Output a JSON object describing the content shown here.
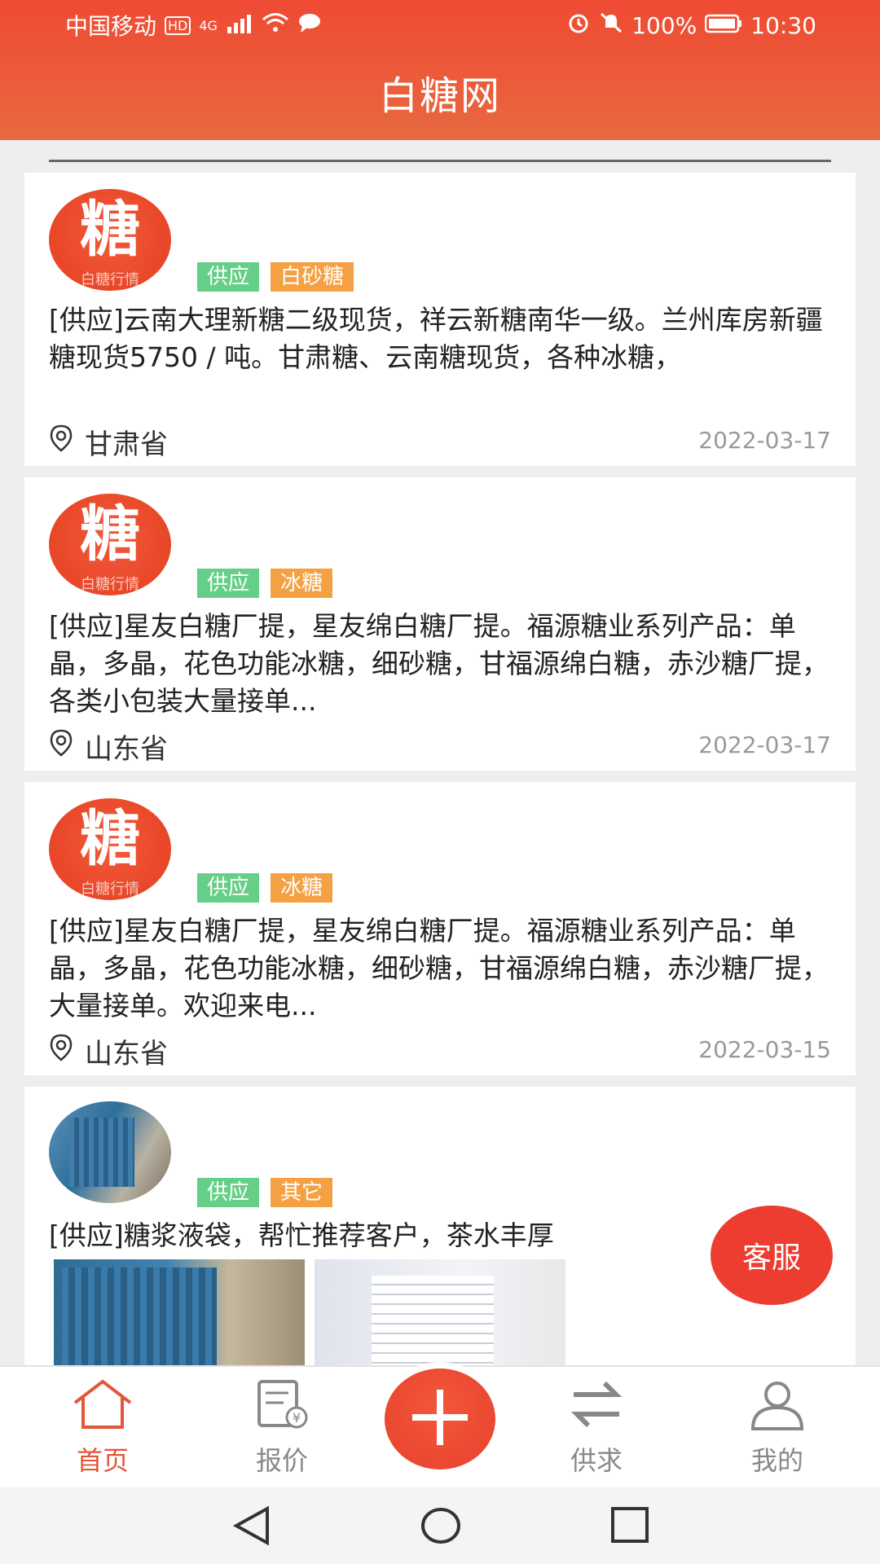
{
  "status_bar": {
    "carrier": "中国移动",
    "hd_badge": "HD",
    "network": "4G",
    "battery_percent": "100%",
    "time": "10:30"
  },
  "header": {
    "title": "白糖网"
  },
  "listings": [
    {
      "avatar_text": "糖",
      "avatar_sub": "白糖行情",
      "tags": [
        "供应",
        "白砂糖"
      ],
      "description": "[供应]云南大理新糖二级现货，祥云新糖南华一级。兰州库房新疆糖现货5750 / 吨。甘肃糖、云南糖现货，各种冰糖，",
      "location": "甘肃省",
      "date": "2022-03-17"
    },
    {
      "avatar_text": "糖",
      "avatar_sub": "白糖行情",
      "tags": [
        "供应",
        "冰糖"
      ],
      "description": "[供应]星友白糖厂提，星友绵白糖厂提。福源糖业系列产品：单晶，多晶，花色功能冰糖，细砂糖，甘福源绵白糖，赤沙糖厂提，各类小包装大量接单...",
      "location": "山东省",
      "date": "2022-03-17"
    },
    {
      "avatar_text": "糖",
      "avatar_sub": "白糖行情",
      "tags": [
        "供应",
        "冰糖"
      ],
      "description": "[供应]星友白糖厂提，星友绵白糖厂提。福源糖业系列产品：单晶，多晶，花色功能冰糖，细砂糖，甘福源绵白糖，赤沙糖厂提，大量接单。欢迎来电...",
      "location": "山东省",
      "date": "2022-03-15"
    },
    {
      "tags": [
        "供应",
        "其它"
      ],
      "description": "[供应]糖浆液袋，帮忙推荐客户，茶水丰厚"
    }
  ],
  "floating": {
    "service_label": "客服"
  },
  "tabbar": {
    "home": "首页",
    "quote": "报价",
    "supply_demand": "供求",
    "mine": "我的"
  },
  "colors": {
    "brand_red": "#e8412d",
    "tag_green": "#65cf87",
    "tag_orange": "#f5a043",
    "active_tab": "#e2573a"
  },
  "icons": [
    "location-pin-icon",
    "home-icon",
    "quote-icon",
    "plus-icon",
    "exchange-icon",
    "user-icon",
    "back-icon",
    "home-circle-icon",
    "recent-apps-icon"
  ]
}
